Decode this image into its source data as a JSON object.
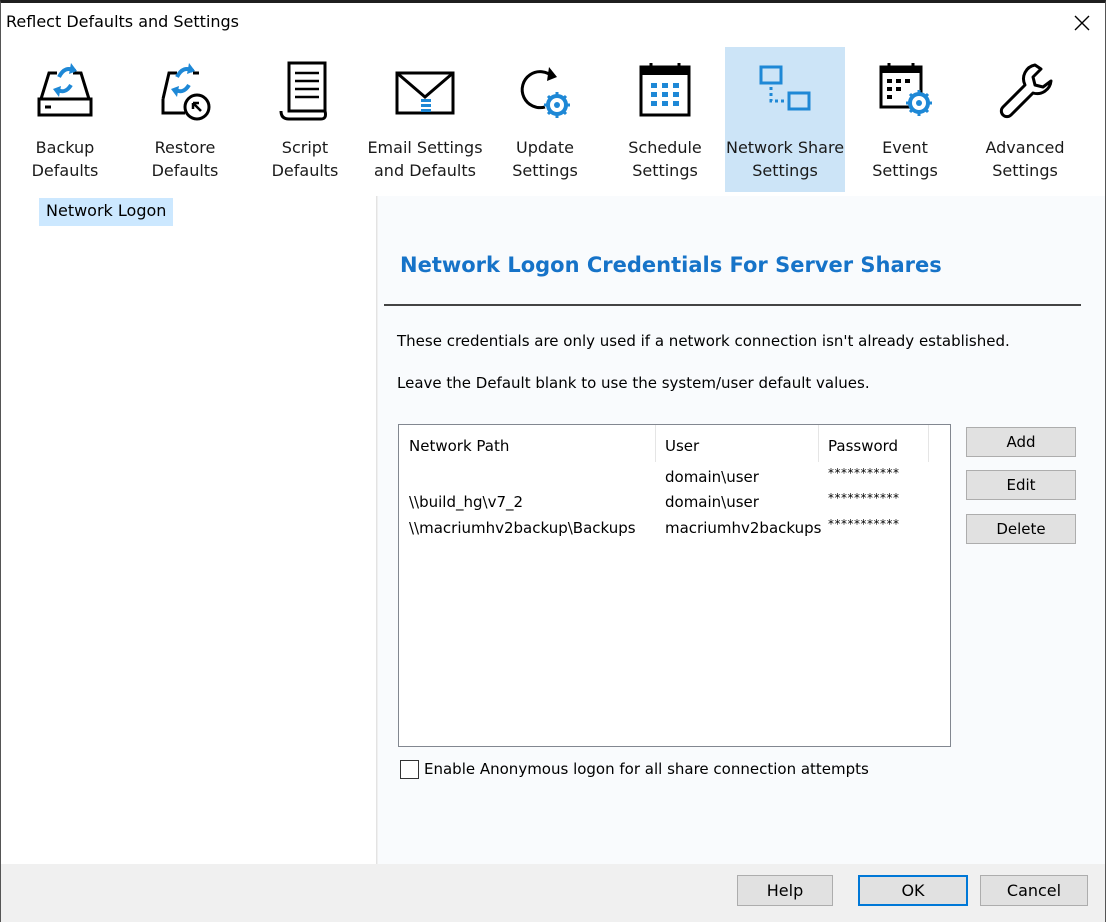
{
  "window": {
    "title": "Reflect Defaults and Settings"
  },
  "toolbar": {
    "items": [
      {
        "label": "Backup\nDefaults",
        "icon": "backup-drive-icon"
      },
      {
        "label": "Restore\nDefaults",
        "icon": "restore-icon"
      },
      {
        "label": "Script\nDefaults",
        "icon": "script-icon"
      },
      {
        "label": "Email Settings\nand Defaults",
        "icon": "email-icon"
      },
      {
        "label": "Update\nSettings",
        "icon": "update-icon"
      },
      {
        "label": "Schedule\nSettings",
        "icon": "calendar-icon"
      },
      {
        "label": "Network Share\nSettings",
        "icon": "network-share-icon",
        "selected": true
      },
      {
        "label": "Event\nSettings",
        "icon": "event-icon"
      },
      {
        "label": "Advanced\nSettings",
        "icon": "wrench-icon"
      }
    ]
  },
  "tree": {
    "selected": "Network Logon"
  },
  "main": {
    "heading": "Network Logon Credentials For Server Shares",
    "info1": "These credentials are only used if a network connection isn't already established.",
    "info2": "Leave the Default blank to use the system/user default values.",
    "columns": [
      "Network Path",
      "User",
      "Password"
    ],
    "rows": [
      {
        "path": "",
        "user": "domain\\user",
        "password": "***********"
      },
      {
        "path": "\\\\build_hg\\v7_2",
        "user": "domain\\user",
        "password": "***********"
      },
      {
        "path": "\\\\macriumhv2backup\\Backups",
        "user": "macriumhv2backups",
        "password": "***********"
      }
    ],
    "buttons": {
      "add": "Add",
      "edit": "Edit",
      "delete": "Delete"
    },
    "anonymous_label": "Enable Anonymous logon for all share connection attempts",
    "anonymous_checked": false
  },
  "footer": {
    "help": "Help",
    "ok": "OK",
    "cancel": "Cancel"
  },
  "colors": {
    "accent": "#1673c8",
    "selected_bg": "#cce4f7",
    "icon_blue": "#1e88d6"
  }
}
